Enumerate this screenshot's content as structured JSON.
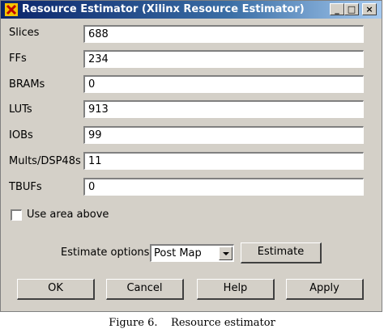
{
  "window": {
    "title": "Resource Estimator (Xilinx Resource Estimator)",
    "controls": {
      "minimize": "_",
      "maximize": "□",
      "close": "×"
    }
  },
  "fields": [
    {
      "label": "Slices",
      "value": "688"
    },
    {
      "label": "FFs",
      "value": "234"
    },
    {
      "label": "BRAMs",
      "value": "0"
    },
    {
      "label": "LUTs",
      "value": "913"
    },
    {
      "label": "IOBs",
      "value": "99"
    },
    {
      "label": "Mults/DSP48s",
      "value": "11"
    },
    {
      "label": "TBUFs",
      "value": "0"
    }
  ],
  "use_area": {
    "label": "Use area above",
    "checked": false
  },
  "estimate_options": {
    "label": "Estimate options",
    "selected": "Post Map",
    "button": "Estimate"
  },
  "buttons": {
    "ok": "OK",
    "cancel": "Cancel",
    "help": "Help",
    "apply": "Apply"
  },
  "caption": "Figure 6.    Resource estimator"
}
